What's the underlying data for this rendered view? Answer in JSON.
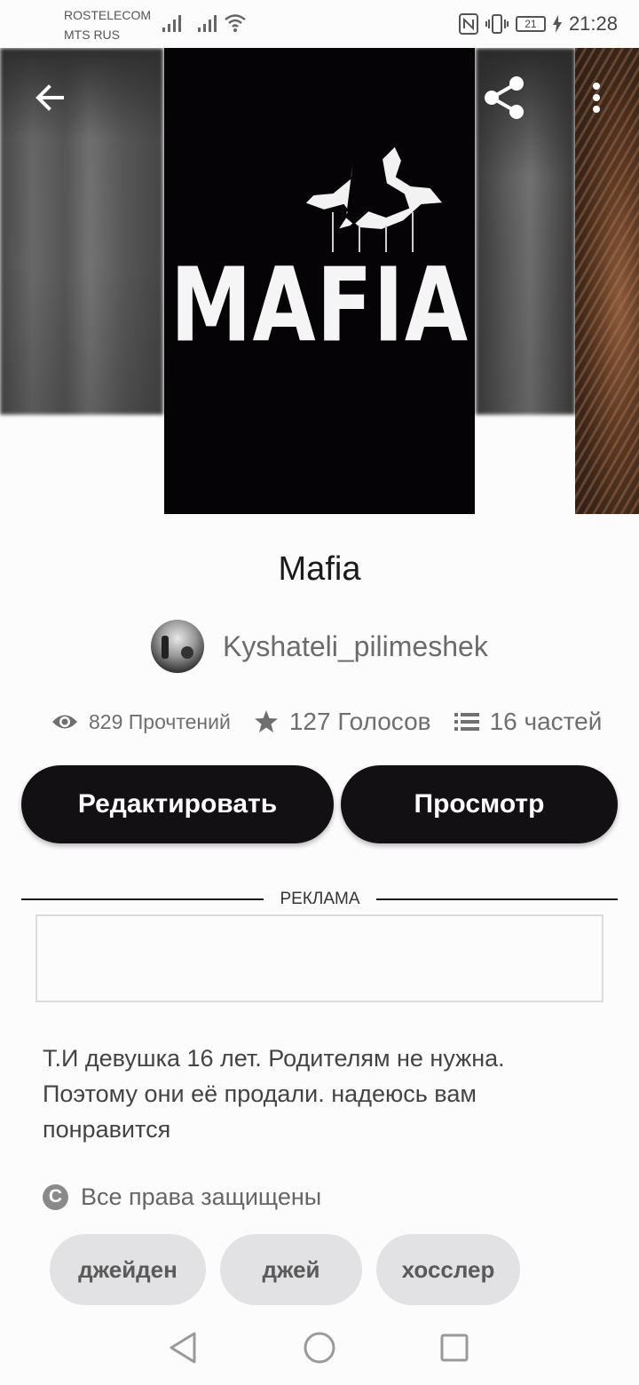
{
  "status_bar": {
    "carrier1": "ROSTELECOM",
    "carrier2": "MTS RUS",
    "battery": "21",
    "time": "21:28"
  },
  "cover": {
    "title": "MAFIA"
  },
  "story": {
    "title": "Mafia",
    "author": "Kyshateli_pilimeshek",
    "stats": {
      "reads": "829 Прочтений",
      "votes": "127 Голосов",
      "parts": "16 частей"
    },
    "edit_label": "Редактировать",
    "view_label": "Просмотр",
    "ad_label": "РЕКЛАМА",
    "description": "Т.И девушка 16 лет. Родителям не нужна. Поэтому они её продали. надеюсь вам понравится",
    "copyright": "Все права защищены",
    "tags": [
      "джейден",
      "джей",
      "хосслер"
    ]
  },
  "icons": {
    "back": "arrow-left-icon",
    "share": "share-icon",
    "more": "more-vertical-icon",
    "eye": "eye-icon",
    "star": "star-icon",
    "list": "list-icon",
    "copyright": "copyright-icon"
  },
  "colors": {
    "button_bg": "#121013",
    "tag_bg": "#e2e1e3",
    "background": "#fdfcfd"
  }
}
